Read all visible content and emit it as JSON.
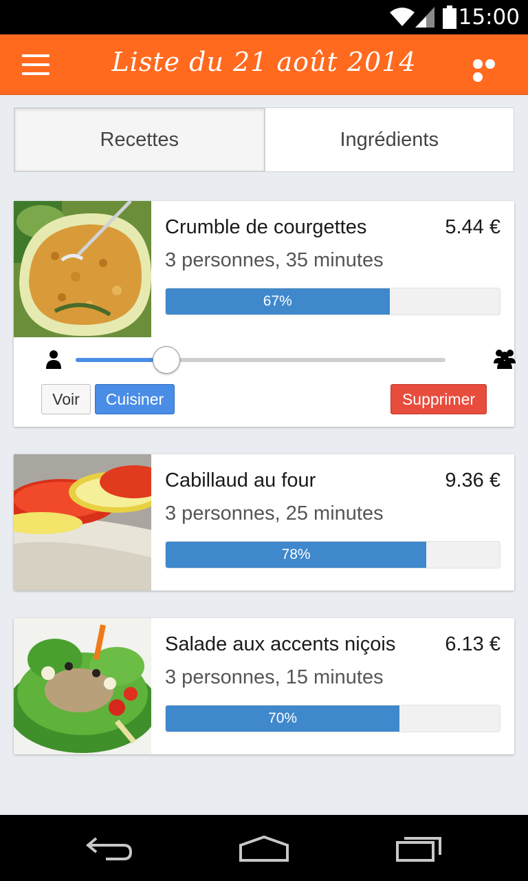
{
  "status_bar": {
    "time": "15:00"
  },
  "app_bar": {
    "title": "Liste du 21 août 2014",
    "menu_icon": "hamburger-menu-icon",
    "more_icon": "overflow-more-icon"
  },
  "tabs": [
    {
      "label": "Recettes",
      "active": true
    },
    {
      "label": "Ingrédients",
      "active": false
    }
  ],
  "recipes": [
    {
      "name": "Crumble de courgettes",
      "price": "5.44 €",
      "meta": "3 personnes, 35 minutes",
      "progress_label": "67%",
      "progress": 0.67,
      "expanded": true
    },
    {
      "name": "Cabillaud au four",
      "price": "9.36 €",
      "meta": "3 personnes, 25 minutes",
      "progress_label": "78%",
      "progress": 0.78,
      "expanded": false
    },
    {
      "name": "Salade aux accents niçois",
      "price": "6.13 €",
      "meta": "3 personnes, 15 minutes",
      "progress_label": "70%",
      "progress": 0.7,
      "expanded": false
    }
  ],
  "servings_slider": {
    "value": 0.245,
    "min_icon": "person-icon",
    "max_icon": "group-icon"
  },
  "actions": {
    "view_label": "Voir",
    "cook_label": "Cuisiner",
    "delete_label": "Supprimer"
  },
  "colors": {
    "accent": "#ff6a1f",
    "progress": "#3f88cc",
    "primary_button": "#4a8de6",
    "danger_button": "#e84c3d"
  }
}
